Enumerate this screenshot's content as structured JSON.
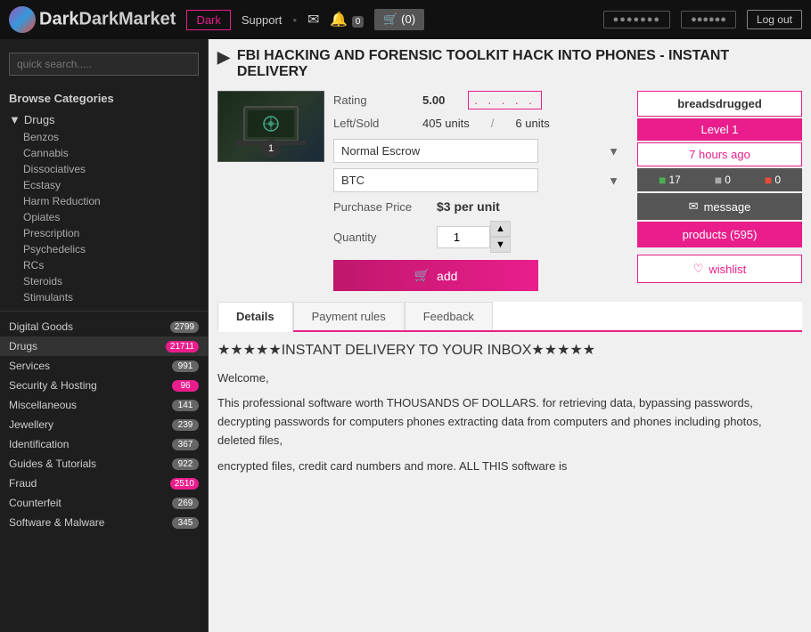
{
  "topnav": {
    "logo_text": "DarkMarket",
    "dark_btn": "Dark",
    "support_link": "Support",
    "cart_label": "(0)",
    "btn1": "●●●●●●●",
    "btn2": "●●●●●●",
    "btn3": "Log out"
  },
  "sidebar": {
    "search_placeholder": "quick search.....",
    "browse_title": "Browse Categories",
    "drugs_label": "Drugs",
    "drug_children": [
      "Benzos",
      "Cannabis",
      "Dissociatives",
      "Ecstasy",
      "Harm Reduction",
      "Opiates",
      "Prescription",
      "Psychedelics",
      "RCs",
      "Steroids",
      "Stimulants"
    ],
    "categories": [
      {
        "name": "Digital Goods",
        "count": "2799",
        "active": false
      },
      {
        "name": "Drugs",
        "count": "21711",
        "active": true
      },
      {
        "name": "Services",
        "count": "991",
        "active": false
      },
      {
        "name": "Security & Hosting",
        "count": "96",
        "active": false
      },
      {
        "name": "Miscellaneous",
        "count": "141",
        "active": false
      },
      {
        "name": "Jewellery",
        "count": "239",
        "active": false
      },
      {
        "name": "Identification",
        "count": "367",
        "active": false
      },
      {
        "name": "Guides & Tutorials",
        "count": "922",
        "active": false
      },
      {
        "name": "Fraud",
        "count": "2510",
        "active": false
      },
      {
        "name": "Counterfeit",
        "count": "269",
        "active": false
      },
      {
        "name": "Software & Malware",
        "count": "345",
        "active": false
      }
    ]
  },
  "product": {
    "title": "FBI HACKING AND FORENSIC TOOLKIT HACK INTO PHONES - INSTANT DELIVERY",
    "rating_num": "5.00",
    "rating_dots": ". . . . .",
    "left_label": "Left/Sold",
    "units_left": "405 units",
    "units_sold": "6 units",
    "escrow_option": "Normal Escrow",
    "crypto_option": "BTC",
    "purchase_price_label": "Purchase Price",
    "price_value": "$3 per unit",
    "quantity_label": "Quantity",
    "quantity_value": "1",
    "add_label": "add"
  },
  "seller": {
    "name": "breadsdrugged",
    "level": "Level 1",
    "time_ago": "7 hours ago",
    "stat_pos": "17",
    "stat_neu": "0",
    "stat_neg": "0",
    "message_label": "message",
    "products_label": "products (595)",
    "wishlist_label": "wishlist"
  },
  "tabs": {
    "details_label": "Details",
    "payment_label": "Payment rules",
    "feedback_label": "Feedback"
  },
  "description": {
    "stars_row": "★★★★★INSTANT DELIVERY TO YOUR INBOX★★★★★",
    "para1": "Welcome,",
    "para2": "This professional software worth THOUSANDS OF DOLLARS. for retrieving data, bypassing passwords, decrypting passwords for computers phones extracting data from computers and phones including photos, deleted files,",
    "para3": "encrypted files, credit card numbers and more. ALL THIS software is"
  }
}
